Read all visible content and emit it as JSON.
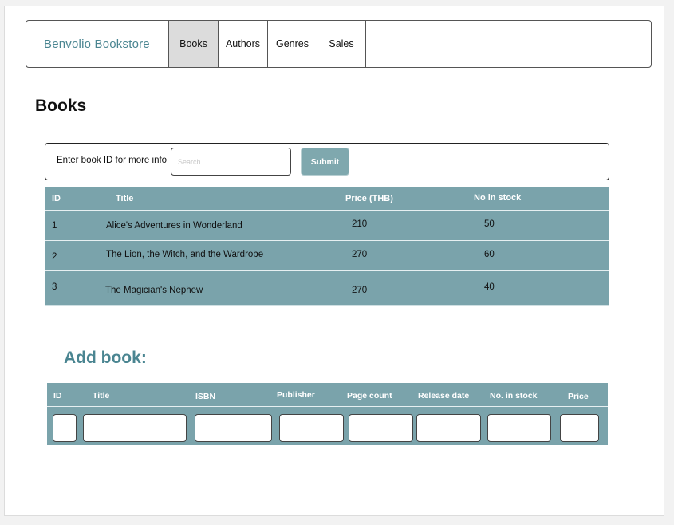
{
  "nav": {
    "brand": "Benvolio Bookstore",
    "items": [
      {
        "label": "Books",
        "active": true
      },
      {
        "label": "Authors",
        "active": false
      },
      {
        "label": "Genres",
        "active": false
      },
      {
        "label": "Sales",
        "active": false
      }
    ]
  },
  "page_title": "Books",
  "search": {
    "label": "Enter book ID for more info",
    "placeholder": "Search...",
    "submit_label": "Submit"
  },
  "books_table": {
    "columns": [
      "ID",
      "Title",
      "Price (THB)",
      "No in stock"
    ],
    "rows": [
      {
        "id": "1",
        "title": "Alice's Adventures in Wonderland",
        "price": "210",
        "stock": "50"
      },
      {
        "id": "2",
        "title": "The Lion, the Witch, and the Wardrobe",
        "price": "270",
        "stock": "60"
      },
      {
        "id": "3",
        "title": "The Magician's Nephew",
        "price": "270",
        "stock": "40"
      }
    ]
  },
  "add_book": {
    "title": "Add book:",
    "columns": [
      "ID",
      "Title",
      "ISBN",
      "Publisher",
      "Page count",
      "Release date",
      "No. in stock",
      "Price"
    ]
  },
  "colors": {
    "table_bg": "#7aa3ab",
    "brand": "#4a8591",
    "button": "#7fa8ae",
    "active_nav": "#dcdcdc"
  }
}
